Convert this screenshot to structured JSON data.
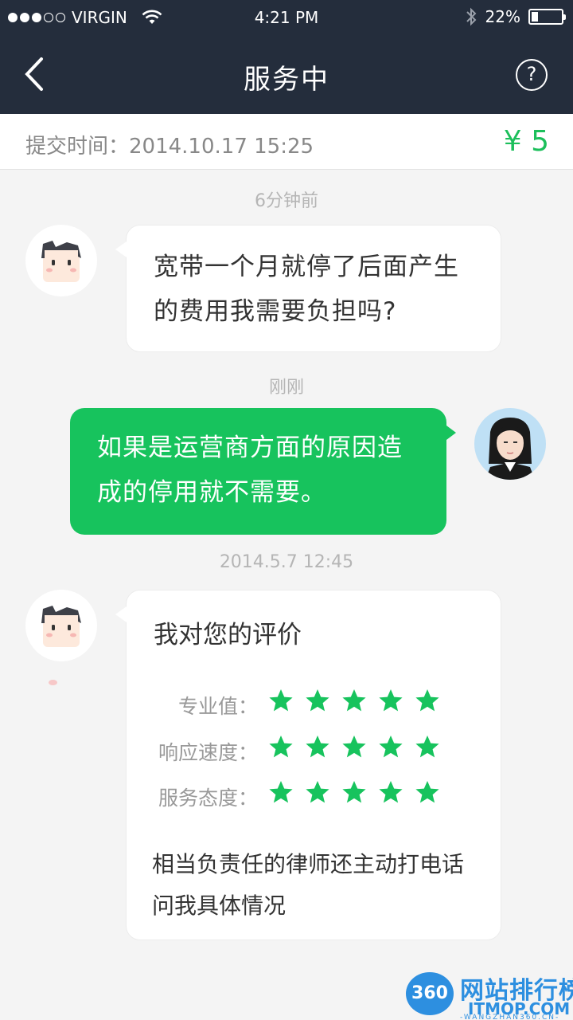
{
  "status_bar": {
    "carrier": "VIRGIN",
    "time": "4:21 PM",
    "battery": "22%",
    "battery_level": 0.22
  },
  "nav": {
    "title": "服务中",
    "back_icon": "chevron-left-icon",
    "help_label": "?"
  },
  "order": {
    "submit_time": "提交时间：2014.10.17  15:25",
    "price": "¥ 5",
    "price_color": "#1cbf5b"
  },
  "messages": [
    {
      "timestamp": "6分钟前",
      "sender": "user",
      "text": "宽带一个月就停了后面产生的费用我需要负担吗?"
    },
    {
      "timestamp": "刚刚",
      "sender": "lawyer",
      "text": "如果是运营商方面的原因造成的停用就不需要。"
    },
    {
      "timestamp": "2014.5.7 12:45",
      "sender": "user",
      "rating": {
        "title": "我对您的评价",
        "rows": [
          {
            "label": "专业值：",
            "stars": 5
          },
          {
            "label": "响应速度：",
            "stars": 5
          },
          {
            "label": "服务态度：",
            "stars": 5
          }
        ],
        "comment": "相当负责任的律师还主动打电话问我具体情况"
      }
    }
  ],
  "watermark": {
    "badge": "360",
    "title": "网站排行榜",
    "sub": "ITMOP.COM",
    "url": "-WANGZHAN360.CN-"
  },
  "colors": {
    "header_bg": "#242d3c",
    "accent_green": "#17c35d",
    "page_bg": "#f4f4f4"
  }
}
